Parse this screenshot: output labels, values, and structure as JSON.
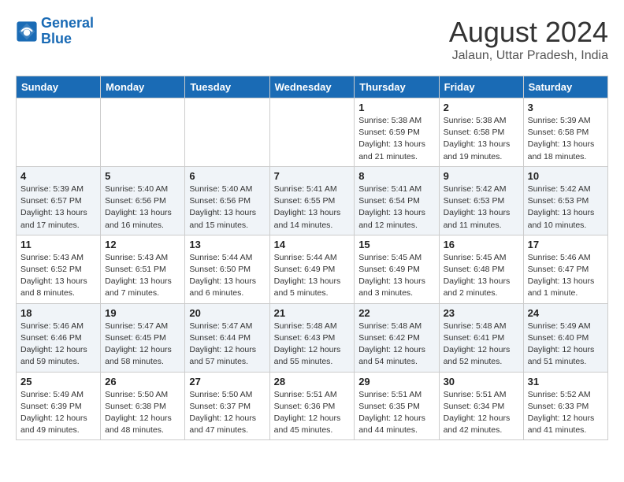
{
  "logo": {
    "line1": "General",
    "line2": "Blue"
  },
  "title": "August 2024",
  "subtitle": "Jalaun, Uttar Pradesh, India",
  "days_header": [
    "Sunday",
    "Monday",
    "Tuesday",
    "Wednesday",
    "Thursday",
    "Friday",
    "Saturday"
  ],
  "weeks": [
    [
      {
        "day": "",
        "info": ""
      },
      {
        "day": "",
        "info": ""
      },
      {
        "day": "",
        "info": ""
      },
      {
        "day": "",
        "info": ""
      },
      {
        "day": "1",
        "info": "Sunrise: 5:38 AM\nSunset: 6:59 PM\nDaylight: 13 hours\nand 21 minutes."
      },
      {
        "day": "2",
        "info": "Sunrise: 5:38 AM\nSunset: 6:58 PM\nDaylight: 13 hours\nand 19 minutes."
      },
      {
        "day": "3",
        "info": "Sunrise: 5:39 AM\nSunset: 6:58 PM\nDaylight: 13 hours\nand 18 minutes."
      }
    ],
    [
      {
        "day": "4",
        "info": "Sunrise: 5:39 AM\nSunset: 6:57 PM\nDaylight: 13 hours\nand 17 minutes."
      },
      {
        "day": "5",
        "info": "Sunrise: 5:40 AM\nSunset: 6:56 PM\nDaylight: 13 hours\nand 16 minutes."
      },
      {
        "day": "6",
        "info": "Sunrise: 5:40 AM\nSunset: 6:56 PM\nDaylight: 13 hours\nand 15 minutes."
      },
      {
        "day": "7",
        "info": "Sunrise: 5:41 AM\nSunset: 6:55 PM\nDaylight: 13 hours\nand 14 minutes."
      },
      {
        "day": "8",
        "info": "Sunrise: 5:41 AM\nSunset: 6:54 PM\nDaylight: 13 hours\nand 12 minutes."
      },
      {
        "day": "9",
        "info": "Sunrise: 5:42 AM\nSunset: 6:53 PM\nDaylight: 13 hours\nand 11 minutes."
      },
      {
        "day": "10",
        "info": "Sunrise: 5:42 AM\nSunset: 6:53 PM\nDaylight: 13 hours\nand 10 minutes."
      }
    ],
    [
      {
        "day": "11",
        "info": "Sunrise: 5:43 AM\nSunset: 6:52 PM\nDaylight: 13 hours\nand 8 minutes."
      },
      {
        "day": "12",
        "info": "Sunrise: 5:43 AM\nSunset: 6:51 PM\nDaylight: 13 hours\nand 7 minutes."
      },
      {
        "day": "13",
        "info": "Sunrise: 5:44 AM\nSunset: 6:50 PM\nDaylight: 13 hours\nand 6 minutes."
      },
      {
        "day": "14",
        "info": "Sunrise: 5:44 AM\nSunset: 6:49 PM\nDaylight: 13 hours\nand 5 minutes."
      },
      {
        "day": "15",
        "info": "Sunrise: 5:45 AM\nSunset: 6:49 PM\nDaylight: 13 hours\nand 3 minutes."
      },
      {
        "day": "16",
        "info": "Sunrise: 5:45 AM\nSunset: 6:48 PM\nDaylight: 13 hours\nand 2 minutes."
      },
      {
        "day": "17",
        "info": "Sunrise: 5:46 AM\nSunset: 6:47 PM\nDaylight: 13 hours\nand 1 minute."
      }
    ],
    [
      {
        "day": "18",
        "info": "Sunrise: 5:46 AM\nSunset: 6:46 PM\nDaylight: 12 hours\nand 59 minutes."
      },
      {
        "day": "19",
        "info": "Sunrise: 5:47 AM\nSunset: 6:45 PM\nDaylight: 12 hours\nand 58 minutes."
      },
      {
        "day": "20",
        "info": "Sunrise: 5:47 AM\nSunset: 6:44 PM\nDaylight: 12 hours\nand 57 minutes."
      },
      {
        "day": "21",
        "info": "Sunrise: 5:48 AM\nSunset: 6:43 PM\nDaylight: 12 hours\nand 55 minutes."
      },
      {
        "day": "22",
        "info": "Sunrise: 5:48 AM\nSunset: 6:42 PM\nDaylight: 12 hours\nand 54 minutes."
      },
      {
        "day": "23",
        "info": "Sunrise: 5:48 AM\nSunset: 6:41 PM\nDaylight: 12 hours\nand 52 minutes."
      },
      {
        "day": "24",
        "info": "Sunrise: 5:49 AM\nSunset: 6:40 PM\nDaylight: 12 hours\nand 51 minutes."
      }
    ],
    [
      {
        "day": "25",
        "info": "Sunrise: 5:49 AM\nSunset: 6:39 PM\nDaylight: 12 hours\nand 49 minutes."
      },
      {
        "day": "26",
        "info": "Sunrise: 5:50 AM\nSunset: 6:38 PM\nDaylight: 12 hours\nand 48 minutes."
      },
      {
        "day": "27",
        "info": "Sunrise: 5:50 AM\nSunset: 6:37 PM\nDaylight: 12 hours\nand 47 minutes."
      },
      {
        "day": "28",
        "info": "Sunrise: 5:51 AM\nSunset: 6:36 PM\nDaylight: 12 hours\nand 45 minutes."
      },
      {
        "day": "29",
        "info": "Sunrise: 5:51 AM\nSunset: 6:35 PM\nDaylight: 12 hours\nand 44 minutes."
      },
      {
        "day": "30",
        "info": "Sunrise: 5:51 AM\nSunset: 6:34 PM\nDaylight: 12 hours\nand 42 minutes."
      },
      {
        "day": "31",
        "info": "Sunrise: 5:52 AM\nSunset: 6:33 PM\nDaylight: 12 hours\nand 41 minutes."
      }
    ]
  ]
}
